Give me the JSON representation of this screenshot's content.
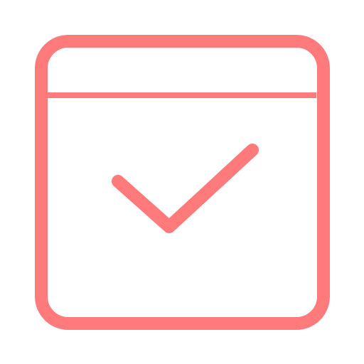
{
  "icon": {
    "name": "calendar-check-icon",
    "color": "#FF7A7A",
    "background": "#FFFFFF"
  }
}
